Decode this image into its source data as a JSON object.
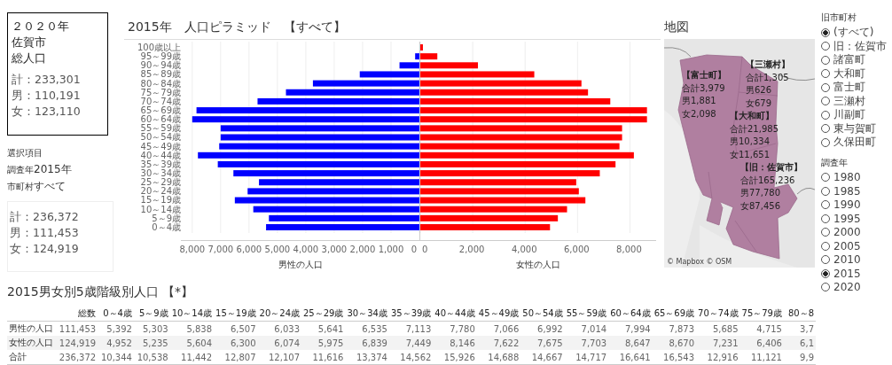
{
  "summary_2020": {
    "heading_lines": [
      "２０２０年",
      "佐賀市",
      "総人口"
    ],
    "lines": [
      "計：233,301",
      "男：110,191",
      "女：123,110"
    ]
  },
  "selection": {
    "title": "選択項目",
    "year_label": "調査年",
    "year": "2015年",
    "municipality_label": "市町村",
    "municipality": "すべて"
  },
  "summary_selected": {
    "lines": [
      "計：236,372",
      "男：111,453",
      "女：124,919"
    ]
  },
  "pyramid": {
    "title": "2015年　人口ピラミッド　【すべて】",
    "male": {
      "chart_data": {
        "type": "bar",
        "orientation": "horizontal",
        "grid": true,
        "xlabel": "男性の人口",
        "xlim": [
          8400,
          0
        ],
        "categories": [
          "100歳以上",
          "95～99歳",
          "90～94歳",
          "85～89歳",
          "80～84歳",
          "75～79歳",
          "70～74歳",
          "65～69歳",
          "60～64歳",
          "55～59歳",
          "50～54歳",
          "45～49歳",
          "40～44歳",
          "35～39歳",
          "30～34歳",
          "25～29歳",
          "20～24歳",
          "15～19歳",
          "10～14歳",
          "5～9歳",
          "0～4歳"
        ],
        "xticks": [
          {
            "value": 8000,
            "label": "8,000"
          },
          {
            "value": 7000,
            "label": "7,000"
          },
          {
            "value": 6000,
            "label": "6,000"
          },
          {
            "value": 5000,
            "label": "5,000"
          },
          {
            "value": 4000,
            "label": "4,000"
          },
          {
            "value": 3000,
            "label": "3,000"
          },
          {
            "value": 2000,
            "label": "2,000"
          },
          {
            "value": 1000,
            "label": "1,000"
          },
          {
            "value": 0,
            "label": "0"
          }
        ],
        "series": [
          {
            "color": "#0000ff",
            "values": [
              0,
              150,
              700,
              2100,
              3750,
              4700,
              5700,
              7850,
              8000,
              7000,
              7000,
              7050,
              7800,
              7100,
              6550,
              5650,
              6050,
              6500,
              5850,
              5300,
              5400
            ]
          }
        ]
      }
    },
    "female": {
      "chart_data": {
        "type": "bar",
        "orientation": "horizontal",
        "grid": true,
        "xlabel": "女性の人口",
        "xlim": [
          0,
          9000
        ],
        "xticks": [
          {
            "value": 0,
            "label": "0"
          },
          {
            "value": 2000,
            "label": "2,000"
          },
          {
            "value": 4000,
            "label": "4,000"
          },
          {
            "value": 6000,
            "label": "6,000"
          },
          {
            "value": 8000,
            "label": "8,000"
          }
        ],
        "series": [
          {
            "color": "#ff0000",
            "values": [
              100,
              650,
              2200,
              4350,
              6150,
              6400,
              7250,
              8650,
              8650,
              7700,
              7700,
              7600,
              8150,
              7450,
              6850,
              5950,
              6050,
              6300,
              5600,
              5250,
              4950
            ]
          }
        ]
      }
    }
  },
  "map": {
    "title": "地図",
    "attribution": "© Mapbox  © OSM",
    "labels": [
      {
        "name": "【富士町】",
        "lines": [
          "合計3,979",
          "男1,881",
          "女2,098"
        ]
      },
      {
        "name": "【三瀬村】",
        "lines": [
          "合計1,305",
          "男626",
          "女679"
        ]
      },
      {
        "name": "【大和町】",
        "lines": [
          "合計21,985",
          "男10,334",
          "女11,651"
        ]
      },
      {
        "name": "【旧：佐賀市】",
        "lines": [
          "合計165,236",
          "男77,780",
          "女87,456"
        ]
      }
    ]
  },
  "filters": [
    {
      "title": "旧市町村",
      "options": [
        {
          "label": "(すべて)",
          "selected": true
        },
        {
          "label": "旧：佐賀市",
          "selected": false
        },
        {
          "label": "諸富町",
          "selected": false
        },
        {
          "label": "大和町",
          "selected": false
        },
        {
          "label": "富士町",
          "selected": false
        },
        {
          "label": "三瀬村",
          "selected": false
        },
        {
          "label": "川副町",
          "selected": false
        },
        {
          "label": "東与賀町",
          "selected": false
        },
        {
          "label": "久保田町",
          "selected": false
        }
      ]
    },
    {
      "title": "調査年",
      "options": [
        {
          "label": "1980",
          "selected": false
        },
        {
          "label": "1985",
          "selected": false
        },
        {
          "label": "1990",
          "selected": false
        },
        {
          "label": "1995",
          "selected": false
        },
        {
          "label": "2000",
          "selected": false
        },
        {
          "label": "2005",
          "selected": false
        },
        {
          "label": "2010",
          "selected": false
        },
        {
          "label": "2015",
          "selected": true
        },
        {
          "label": "2020",
          "selected": false
        }
      ]
    }
  ],
  "table": {
    "title": "2015男女別5歳階級別人口 【*】",
    "columns": [
      "総数",
      "0～4歳",
      "5～9歳",
      "10～14歳",
      "15～19歳",
      "20～24歳",
      "25～29歳",
      "30～34歳",
      "35～39歳",
      "40～44歳",
      "45～49歳",
      "50～54歳",
      "55～59歳",
      "60～64歳",
      "65～69歳",
      "70～74歳",
      "75～79歳",
      "80～8"
    ],
    "rows": [
      {
        "label": "男性の人口",
        "cells": [
          "111,453",
          "5,392",
          "5,303",
          "5,838",
          "6,507",
          "6,033",
          "5,641",
          "6,535",
          "7,113",
          "7,780",
          "7,066",
          "6,992",
          "7,014",
          "7,994",
          "7,873",
          "5,685",
          "4,715",
          "3,7"
        ]
      },
      {
        "label": "女性の人口",
        "cells": [
          "124,919",
          "4,952",
          "5,235",
          "5,604",
          "6,300",
          "6,074",
          "5,975",
          "6,839",
          "7,449",
          "8,146",
          "7,622",
          "7,675",
          "7,703",
          "8,647",
          "8,670",
          "7,231",
          "6,406",
          "6,1"
        ]
      },
      {
        "label": "合計",
        "cells": [
          "236,372",
          "10,344",
          "10,538",
          "11,442",
          "12,807",
          "12,107",
          "11,616",
          "13,374",
          "14,562",
          "15,926",
          "14,688",
          "14,667",
          "14,717",
          "16,641",
          "16,543",
          "12,916",
          "11,121",
          "9,9"
        ]
      }
    ]
  }
}
